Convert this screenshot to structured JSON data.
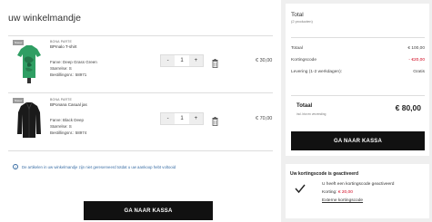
{
  "cart": {
    "title": "uw winkelmandje",
    "items": [
      {
        "tag": "Nieuw",
        "brand": "BONA PARTE",
        "name": "BPmalo T-shirt",
        "color": "Farve: Deep Grass Green",
        "size": "Størrelse: S",
        "order_no": "Bestillingsnr.: 58971",
        "qty": "1",
        "minus": "-",
        "plus": "+",
        "price": "€ 30,00",
        "garment_color": "#2f9e63"
      },
      {
        "tag": "Nieuw",
        "brand": "BONA PARTE",
        "name": "BPonana Casual jas",
        "color": "Farve: Black Deep",
        "size": "Størrelse: S",
        "order_no": "Bestillingsnr.: 58974",
        "qty": "1",
        "minus": "-",
        "plus": "+",
        "price": "€ 70,00",
        "garment_color": "#1a1a1a"
      }
    ],
    "notice": "De artikelen in uw winkelmandje zijn niet gereserveerd totdat u uw aankoop hebt voltooid",
    "checkout_button": "GA NAAR KASSA"
  },
  "summary": {
    "title": "Total",
    "subtitle": "(2 producten)",
    "rows": [
      {
        "label": "Totaal",
        "value": "€ 100,00"
      },
      {
        "label": "Kortingscode",
        "value": "- €20,00"
      },
      {
        "label": "Levering (1-2 werkdagen):",
        "value": "Gratis"
      }
    ],
    "total_label": "Totaal",
    "total_sub": "incl. btw en verzending",
    "total_value": "€ 80,00",
    "checkout_button": "GA NAAR KASSA"
  },
  "discount": {
    "title": "Uw kortingscode is geactiveerd",
    "line1": "U heeft een kortingscode geactiveerd",
    "line2_label": "Korting: ",
    "line2_value": "€ 20,00",
    "link": "Externe kortingscode"
  },
  "colors": {
    "accent": "#111111",
    "discount_red": "#d0021b",
    "link_blue": "#3a6ea5"
  }
}
